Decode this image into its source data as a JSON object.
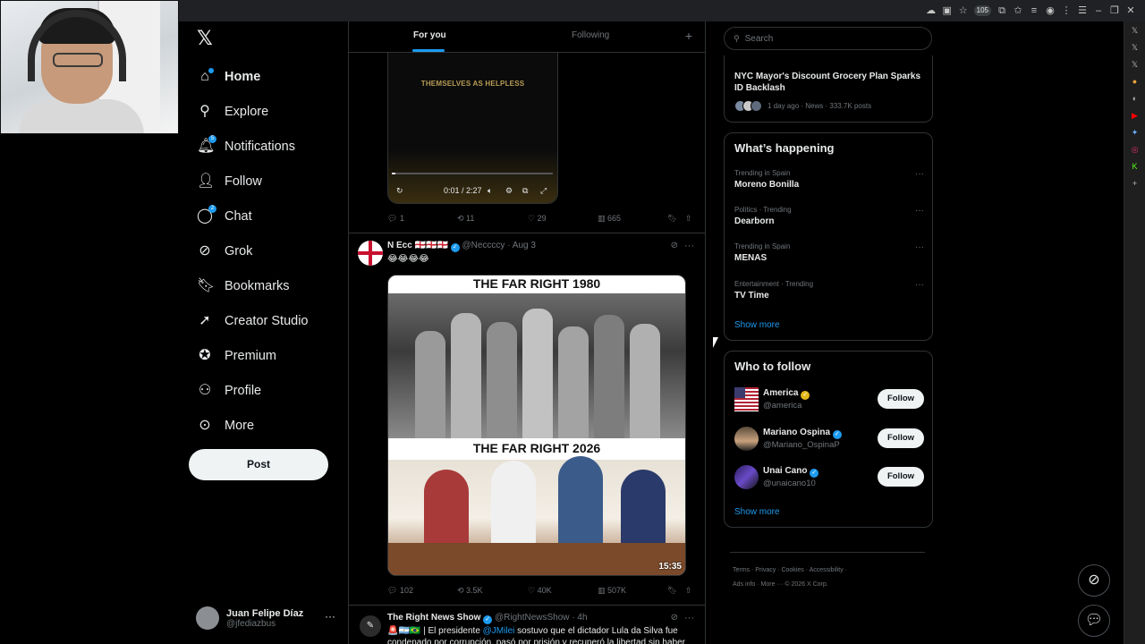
{
  "browser": {
    "extension_badge": "105"
  },
  "nav": {
    "items": [
      {
        "label": "Home",
        "icon": "home-icon"
      },
      {
        "label": "Explore",
        "icon": "search-icon"
      },
      {
        "label": "Notifications",
        "icon": "bell-icon",
        "badge": "5"
      },
      {
        "label": "Follow",
        "icon": "person-add-icon"
      },
      {
        "label": "Chat",
        "icon": "chat-icon",
        "badge": "2"
      },
      {
        "label": "Grok",
        "icon": "grok-icon"
      },
      {
        "label": "Bookmarks",
        "icon": "bookmark-icon"
      },
      {
        "label": "Creator Studio",
        "icon": "rocket-icon"
      },
      {
        "label": "Premium",
        "icon": "verified-icon"
      },
      {
        "label": "Profile",
        "icon": "profile-icon"
      },
      {
        "label": "More",
        "icon": "more-circle-icon"
      }
    ],
    "post_label": "Post"
  },
  "account": {
    "name": "Juan Felipe Díaz",
    "handle": "@jfediazbus"
  },
  "tabs": {
    "for_you": "For you",
    "following": "Following"
  },
  "video_post": {
    "overlay_text": "THEMSELVES AS HELPLESS",
    "time": "0:01 / 2:27",
    "progress": 0.007,
    "replies": "1",
    "reposts": "11",
    "likes": "29",
    "views": "665"
  },
  "post2": {
    "name": "N Ecc",
    "flags": "🏴󠁧󠁢󠁥󠁮󠁧󠁿🏴󠁧󠁢󠁥󠁮󠁧󠁿🏴󠁧󠁢󠁥󠁮󠁧󠁿",
    "handle": "@Neccccy",
    "time": "· Aug 3",
    "text": "😂😂😂😂",
    "meme_top": "THE FAR RIGHT 1980",
    "meme_bottom": "THE FAR RIGHT 2026",
    "duration": "15:35",
    "replies": "102",
    "reposts": "3.5K",
    "likes": "40K",
    "views": "507K"
  },
  "post3": {
    "name": "The Right News Show",
    "handle": "@RightNewsShow",
    "time": "· 4h",
    "text_start": "🚨🇦🇷🇧🇷 | El presidente ",
    "mention": "@JMilei",
    "text_end": " sostuvo que el dictador Lula da Silva fue condenado por corrupción, pasó por prisión y recuperó la libertad sin haber"
  },
  "right": {
    "search_placeholder": "Search",
    "news": {
      "title": "NYC Mayor's Discount Grocery Plan Sparks ID Backlash",
      "meta": "1 day ago · News · 333.7K posts"
    },
    "whats_happening": "What’s happening",
    "trends": [
      {
        "meta": "Trending in Spain",
        "name": "Moreno Bonilla"
      },
      {
        "meta": "Politics · Trending",
        "name": "Dearborn"
      },
      {
        "meta": "Trending in Spain",
        "name": "MENAS"
      },
      {
        "meta": "Entertainment · Trending",
        "name": "TV Time"
      }
    ],
    "show_more": "Show more",
    "who_to_follow": "Who to follow",
    "follow_suggestions": [
      {
        "name": "America",
        "handle": "@america",
        "badge": "gold"
      },
      {
        "name": "Mariano Ospina",
        "handle": "@Mariano_OspinaP",
        "badge": "blue"
      },
      {
        "name": "Unai Cano",
        "handle": "@unaicano10",
        "badge": "blue"
      }
    ],
    "follow_label": "Follow",
    "footer": {
      "line1": "Terms · Privacy · Cookies · Accessibility ·",
      "line2": "Ads info · More ··· © 2026 X Corp."
    }
  }
}
